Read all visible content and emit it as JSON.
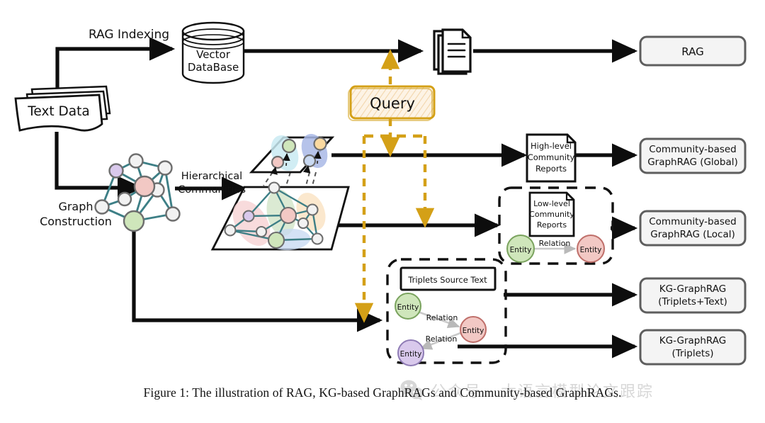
{
  "figure": {
    "caption": "Figure 1: The illustration of RAG, KG-based GraphRAGs and Community-based GraphRAGs.",
    "watermark_text": "公众号 · 大语言模型论文跟踪",
    "watermark_icon": "wechat-icon"
  },
  "nodes": {
    "text_data": "Text Data",
    "vector_db_line1": "Vector",
    "vector_db_line2": "DataBase",
    "query": "Query",
    "documents_icon": "documents-stack-icon",
    "high_level_reports": [
      "High-level",
      "Community",
      "Reports"
    ],
    "low_level_reports": [
      "Low-level",
      "Community",
      "Reports"
    ],
    "triplets_source_text": "Triplets Source Text"
  },
  "edge_labels": {
    "rag_indexing": "RAG Indexing",
    "graph_construction_line1": "Graph",
    "graph_construction_line2": "Construction",
    "hierarchical_line1": "Hierarchical",
    "hierarchical_line2": "Communities"
  },
  "entities": {
    "entity": "Entity",
    "relation": "Relation"
  },
  "outputs": [
    {
      "id": "rag",
      "lines": [
        "RAG"
      ]
    },
    {
      "id": "community-global",
      "lines": [
        "Community-based",
        "GraphRAG (Global)"
      ]
    },
    {
      "id": "community-local",
      "lines": [
        "Community-based",
        "GraphRAG (Local)"
      ]
    },
    {
      "id": "kg-triplets-text",
      "lines": [
        "KG-GraphRAG",
        "(Triplets+Text)"
      ]
    },
    {
      "id": "kg-triplets",
      "lines": [
        "KG-GraphRAG",
        "(Triplets)"
      ]
    }
  ],
  "colors": {
    "flow_arrow": "#0d0d0d",
    "query_border": "#d4a017",
    "query_fill": "#fdf2e2",
    "query_hatch": "#f3d7b0",
    "query_dash": "#d4a017",
    "graph_edge": "#3d7f86",
    "node_gray_fill": "#f2f2f2",
    "node_gray_stroke": "#6e6e6e",
    "node_purple": "#d9c9ec",
    "node_red": "#f2c8c4",
    "node_green": "#cfe6bb",
    "node_orange": "#fad9a0",
    "node_blue": "#c9d9f2",
    "community_pink": "#f6cfd0",
    "community_green": "#cfe3c4",
    "community_orange": "#fae0bd",
    "community_blue": "#c5d8f2",
    "community_cyan": "#c9eaf2",
    "community_indigo": "#a9b8e6",
    "output_box_border": "#5e5e5e",
    "output_box_fill": "#f4f4f4",
    "dashed_group": "#111111"
  },
  "graph_main": {
    "edges": 15,
    "node_count": 10,
    "description": "knowledge graph with teal edges and colored entity nodes"
  },
  "planes": {
    "upper": {
      "label": "high-level community plane",
      "clusters": 2
    },
    "lower": {
      "label": "low-level community plane",
      "clusters": 4
    }
  }
}
